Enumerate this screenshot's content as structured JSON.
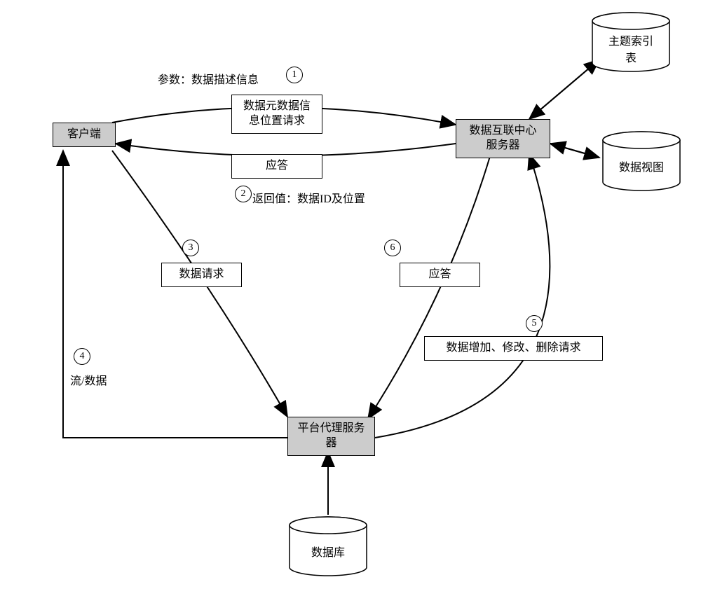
{
  "nodes": {
    "client": "客户端",
    "interconnect_server_line1": "数据互联中心",
    "interconnect_server_line2": "服务器",
    "proxy_server_line1": "平台代理服务",
    "proxy_server_line2": "器"
  },
  "cylinders": {
    "topic_index_line1": "主题索引",
    "topic_index_line2": "表",
    "data_view": "数据视图",
    "database": "数据库"
  },
  "messages": {
    "metadata_request_line1": "数据元数据信",
    "metadata_request_line2": "息位置请求",
    "response1": "应答",
    "data_request": "数据请求",
    "response2": "应答",
    "crud_request": "数据增加、修改、删除请求"
  },
  "labels": {
    "params": "参数：数据描述信息",
    "return_value": "返回值：数据ID及位置",
    "flow_data": "流/数据"
  },
  "steps": {
    "s1": "1",
    "s2": "2",
    "s3": "3",
    "s4": "4",
    "s5": "5",
    "s6": "6"
  }
}
